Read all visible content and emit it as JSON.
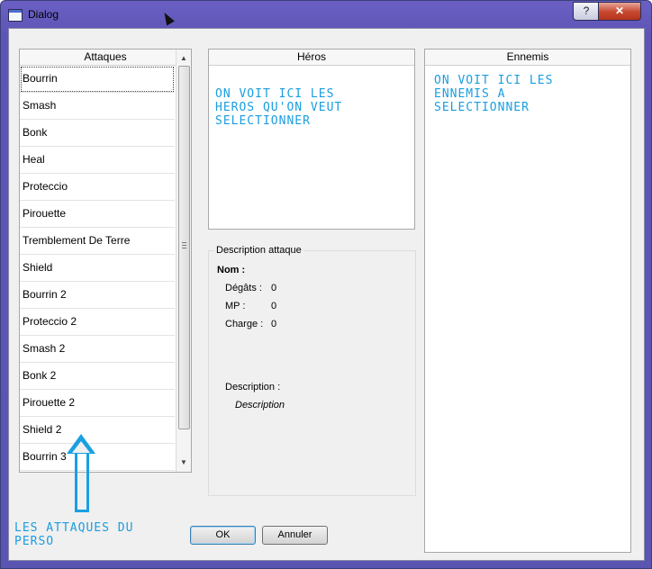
{
  "window": {
    "title": "Dialog",
    "help_label": "?",
    "close_label": "✕"
  },
  "attaques": {
    "header": "Attaques",
    "items": [
      "Bourrin",
      "Smash",
      "Bonk",
      "Heal",
      "Proteccio",
      "Pirouette",
      "Tremblement De Terre",
      "Shield",
      "Bourrin 2",
      "Proteccio 2",
      "Smash 2",
      "Bonk 2",
      "Pirouette 2",
      "Shield 2",
      "Bourrin 3"
    ],
    "selected_index": 0
  },
  "heros": {
    "header": "Héros",
    "annotation": "ON VOIT ICI LES\nHEROS QU'ON VEUT\nSELECTIONNER"
  },
  "ennemis": {
    "header": "Ennemis",
    "annotation": "ON VOIT ICI LES\nENNEMIS A\nSELECTIONNER"
  },
  "description_attaque": {
    "title": "Description attaque",
    "nom_label": "Nom :",
    "degats_label": "Dégâts :",
    "degats_value": "0",
    "mp_label": "MP :",
    "mp_value": "0",
    "charge_label": "Charge :",
    "charge_value": "0",
    "description_label": "Description :",
    "description_value": "Description"
  },
  "buttons": {
    "ok": "OK",
    "cancel": "Annuler"
  },
  "annotation_attaques": "LES ATTAQUES DU\nPERSO",
  "icons": {
    "arrow": "up-arrow-annotation",
    "cursor": "mouse-cursor"
  }
}
